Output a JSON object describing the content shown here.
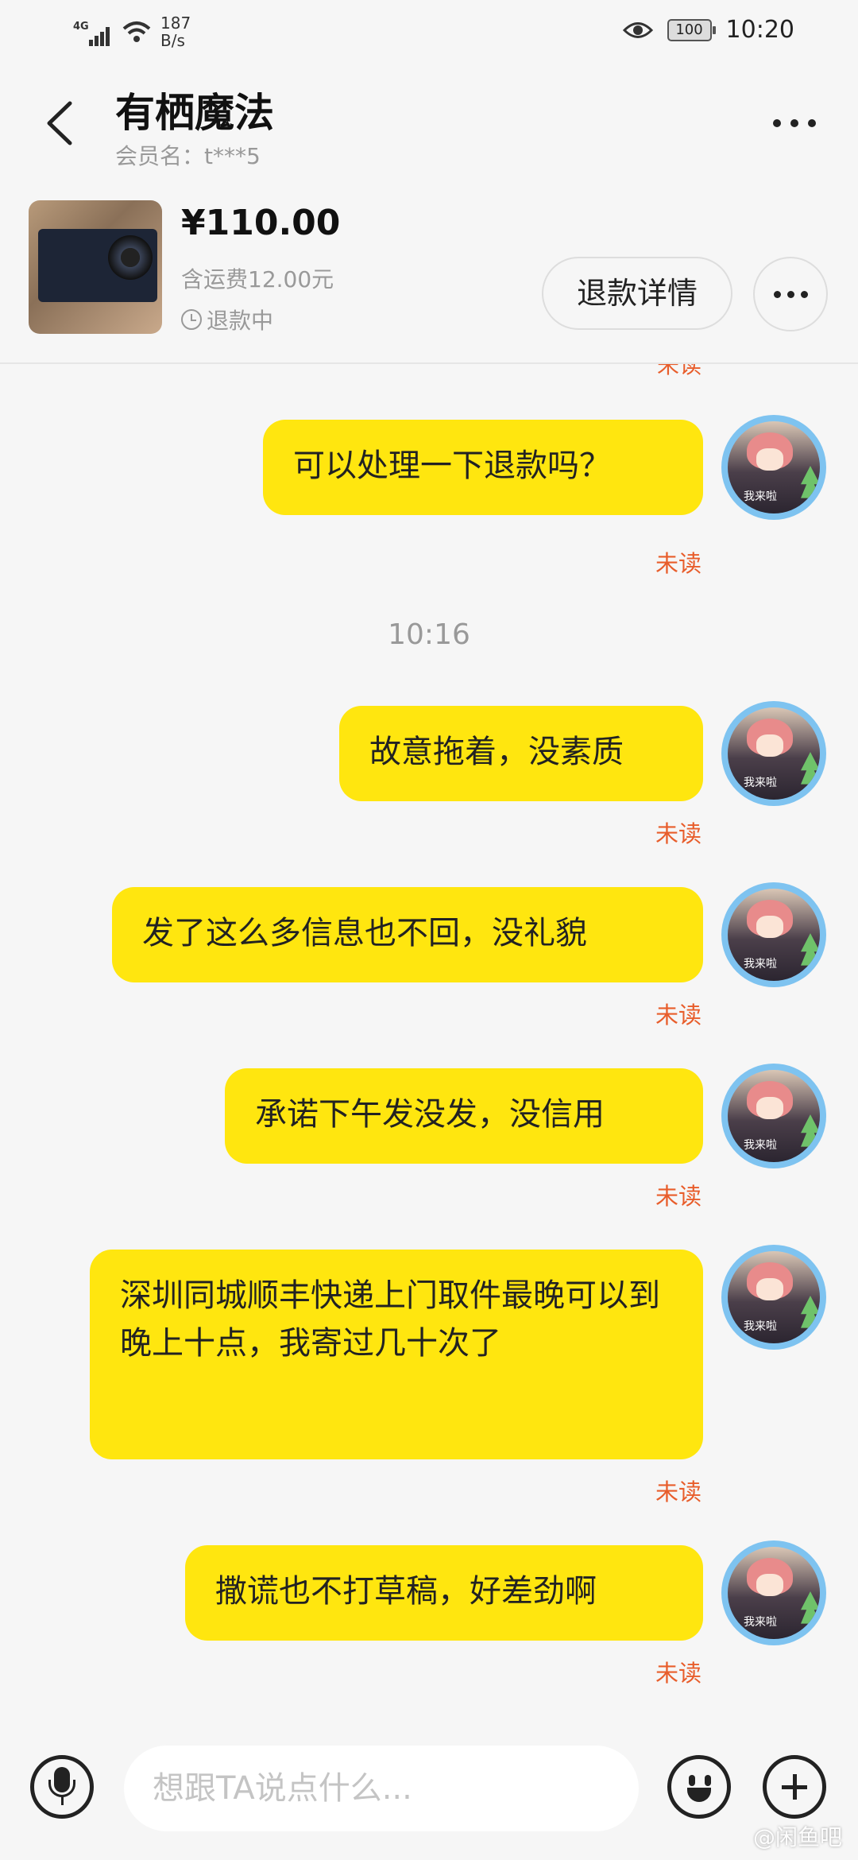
{
  "status_bar": {
    "network": "4G",
    "speed_value": "187",
    "speed_unit": "B/s",
    "battery": "100",
    "time": "10:20"
  },
  "header": {
    "title": "有栖魔法",
    "member": "会员名：t***5"
  },
  "product": {
    "price": "¥110.00",
    "shipping": "含运费12.00元",
    "status": "退款中",
    "refund_button": "退款详情"
  },
  "messages": [
    {
      "text": "可以处理一下退款吗？",
      "status": "未读"
    },
    {
      "text": "故意拖着，没素质",
      "status": "未读"
    },
    {
      "text": "发了这么多信息也不回，没礼貌",
      "status": "未读"
    },
    {
      "text": "承诺下午发没发，没信用",
      "status": "未读"
    },
    {
      "text": "深圳同城顺丰快递上门取件最晚可以到晚上十点，我寄过几十次了",
      "status": "未读"
    },
    {
      "text": "撒谎也不打草稿，好差劲啊",
      "status": "未读"
    }
  ],
  "partial_status": "未读",
  "timestamp": "10:16",
  "avatar_text": "我来啦",
  "input": {
    "placeholder": "想跟TA说点什么..."
  },
  "watermark": "@闲鱼吧",
  "colors": {
    "bubble": "#ffe60f",
    "unread": "#e85d2b",
    "background": "#f6f6f6"
  }
}
